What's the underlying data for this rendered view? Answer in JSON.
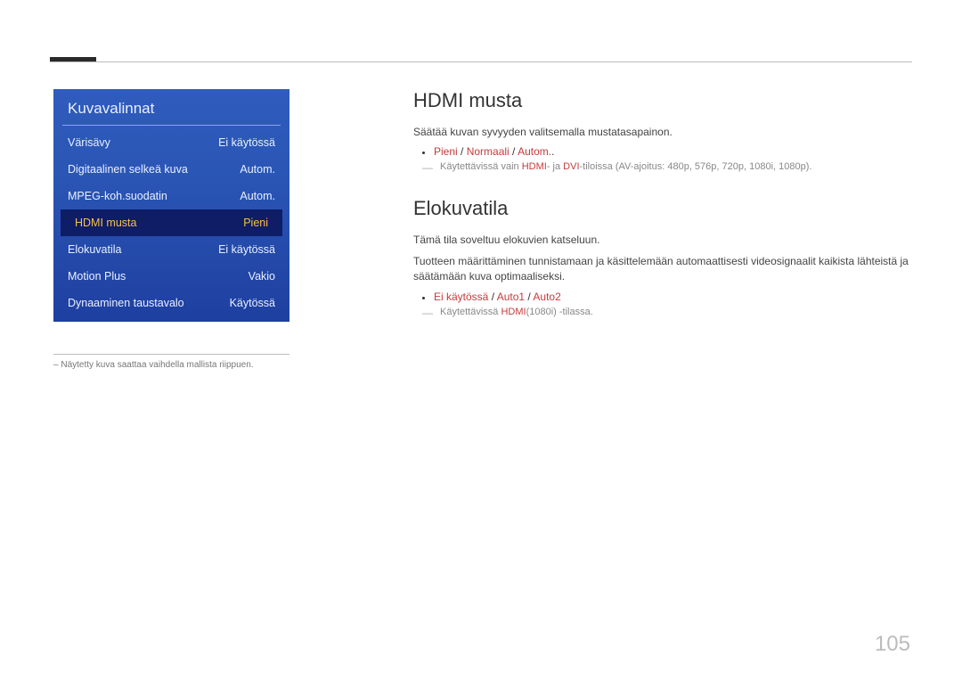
{
  "page_number": "105",
  "menu": {
    "title": "Kuvavalinnat",
    "items": [
      {
        "label": "Värisävy",
        "value": "Ei käytössä"
      },
      {
        "label": "Digitaalinen selkeä kuva",
        "value": "Autom."
      },
      {
        "label": "MPEG-koh.suodatin",
        "value": "Autom."
      },
      {
        "label": "HDMI musta",
        "value": "Pieni",
        "selected": true
      },
      {
        "label": "Elokuvatila",
        "value": "Ei käytössä"
      },
      {
        "label": "Motion Plus",
        "value": "Vakio"
      },
      {
        "label": "Dynaaminen taustavalo",
        "value": "Käytössä"
      }
    ]
  },
  "footnote_prefix": "–",
  "footnote": "Näytetty kuva saattaa vaihdella mallista riippuen.",
  "sections": {
    "hdmi": {
      "title": "HDMI musta",
      "desc": "Säätää kuvan syvyyden valitsemalla mustatasapainon.",
      "options": {
        "o1": "Pieni",
        "sep": " / ",
        "o2": "Normaali",
        "o3": "Autom."
      },
      "note_pre": "Käytettävissä vain ",
      "note_hl1": "HDMI",
      "note_mid": "- ja ",
      "note_hl2": "DVI",
      "note_post": "-tiloissa (AV-ajoitus: 480p, 576p, 720p, 1080i, 1080p)."
    },
    "elokuva": {
      "title": "Elokuvatila",
      "desc1": "Tämä tila soveltuu elokuvien katseluun.",
      "desc2": "Tuotteen määrittäminen tunnistamaan ja käsittelemään automaattisesti videosignaalit kaikista lähteistä ja säätämään kuva optimaaliseksi.",
      "options": {
        "o1": "Ei käytössä",
        "sep": " / ",
        "o2": "Auto1",
        "o3": "Auto2"
      },
      "note_pre": "Käytettävissä ",
      "note_hl": "HDMI",
      "note_post": "(1080i) -tilassa."
    }
  }
}
